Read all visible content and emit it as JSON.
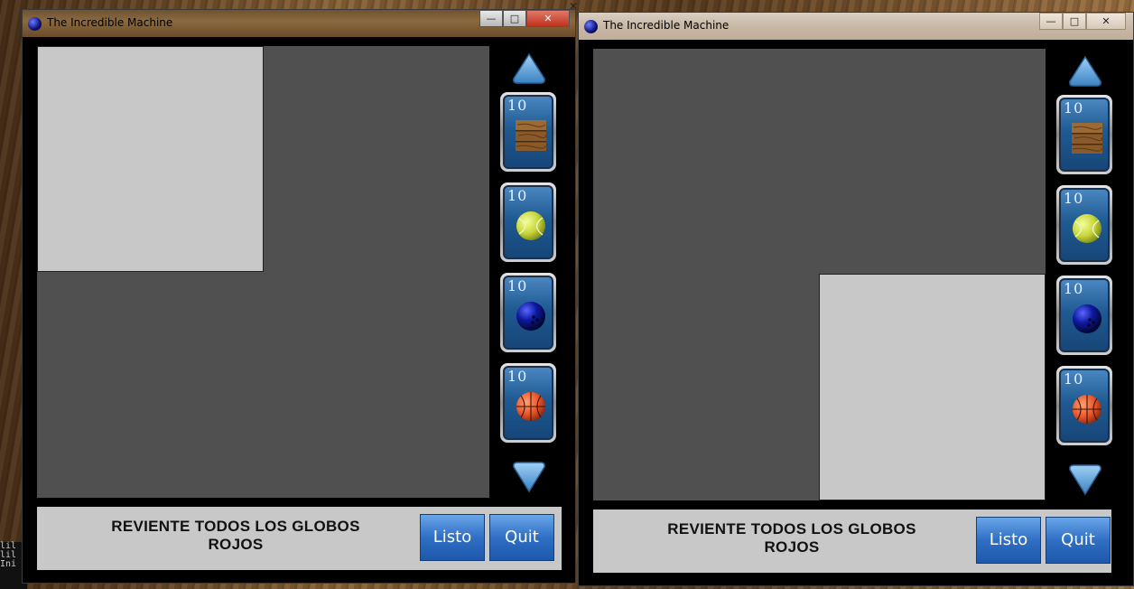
{
  "desktop": {
    "terminal_lines": [
      "lil",
      "lil",
      "Ini"
    ]
  },
  "windows": [
    {
      "title": "The Incredible Machine",
      "controls": {
        "minimize": "—",
        "maximize": "□",
        "close": "✕"
      },
      "goal_line1": "REVIENTE TODOS LOS GLOBOS",
      "goal_line2": "ROJOS",
      "listo_label": "Listo",
      "quit_label": "Quit",
      "parts": [
        {
          "count": "10",
          "icon": "wood-plank-icon"
        },
        {
          "count": "10",
          "icon": "tennis-ball-icon"
        },
        {
          "count": "10",
          "icon": "bowling-ball-icon"
        },
        {
          "count": "10",
          "icon": "basketball-icon"
        }
      ]
    },
    {
      "title": "The Incredible Machine",
      "controls": {
        "minimize": "—",
        "maximize": "□",
        "close": "✕"
      },
      "goal_line1": "REVIENTE TODOS LOS GLOBOS",
      "goal_line2": "ROJOS",
      "listo_label": "Listo",
      "quit_label": "Quit",
      "parts": [
        {
          "count": "10",
          "icon": "wood-plank-icon"
        },
        {
          "count": "10",
          "icon": "tennis-ball-icon"
        },
        {
          "count": "10",
          "icon": "bowling-ball-icon"
        },
        {
          "count": "10",
          "icon": "basketball-icon"
        }
      ]
    }
  ],
  "colors": {
    "board": "#505050",
    "drop_zone": "#c8c8c8",
    "button_blue": "#2f6fc4",
    "slot_blue": "#1f5a92"
  }
}
